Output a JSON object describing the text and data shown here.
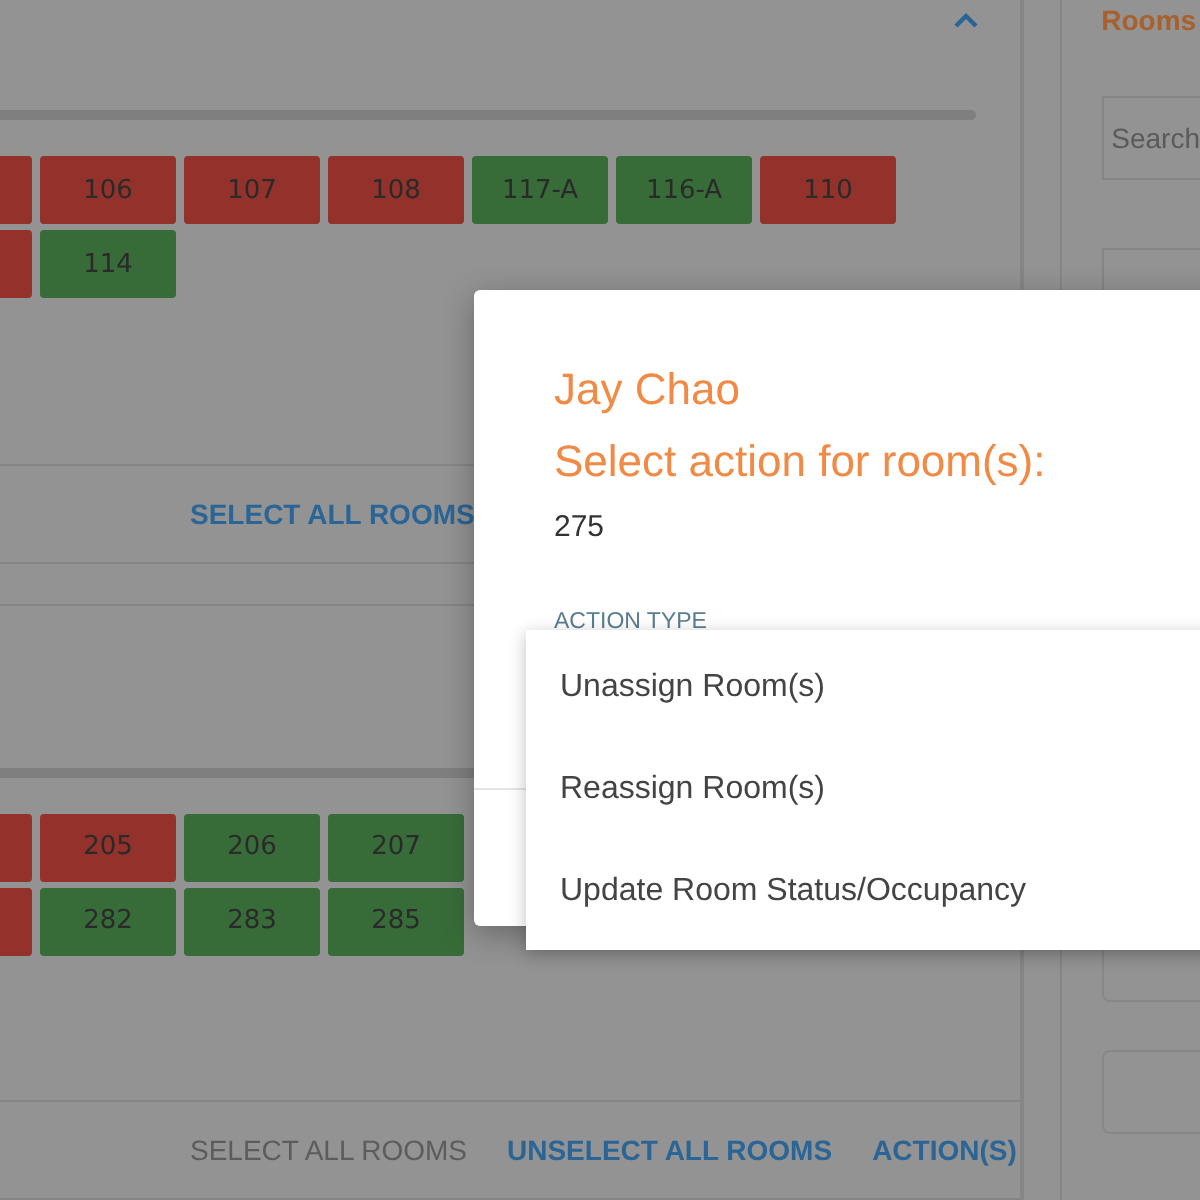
{
  "sections": [
    {
      "rows": [
        [
          {
            "color": "#92322a"
          },
          {
            "label": "106",
            "color": "#92322a"
          },
          {
            "label": "107",
            "color": "#92322a"
          },
          {
            "label": "108",
            "color": "#92322a"
          },
          {
            "label": "117-A",
            "color": "#376c39"
          },
          {
            "label": "116-A",
            "color": "#376c39"
          },
          {
            "label": "110",
            "color": "#92322a"
          }
        ],
        [
          {
            "color": "#92322a"
          },
          {
            "label": "114",
            "color": "#376c39"
          }
        ]
      ],
      "actions": [
        {
          "label": "SELECT ALL ROOMS",
          "disabled": false
        }
      ]
    },
    {
      "rows": [
        [
          {
            "color": "#92322a"
          },
          {
            "label": "205",
            "color": "#92322a"
          },
          {
            "label": "206",
            "color": "#376c39"
          },
          {
            "label": "207",
            "color": "#376c39"
          }
        ],
        [
          {
            "color": "#92322a"
          },
          {
            "label": "282",
            "color": "#376c39"
          },
          {
            "label": "283",
            "color": "#376c39"
          },
          {
            "label": "285",
            "color": "#376c39"
          }
        ]
      ],
      "actions": [
        {
          "label": "SELECT ALL ROOMS",
          "disabled": true
        },
        {
          "label": "UNSELECT ALL ROOMS",
          "disabled": false
        },
        {
          "label": "ACTION(S)",
          "disabled": false
        }
      ]
    }
  ],
  "sidebar": {
    "title": "Rooms",
    "search": {
      "placeholder": "Search"
    }
  },
  "modal": {
    "name": "Jay Chao",
    "heading": "Select action for room(s):",
    "rooms": "275",
    "field_label": "ACTION TYPE",
    "options": [
      "Unassign Room(s)",
      "Reassign Room(s)",
      "Update Room Status/Occupancy"
    ]
  }
}
